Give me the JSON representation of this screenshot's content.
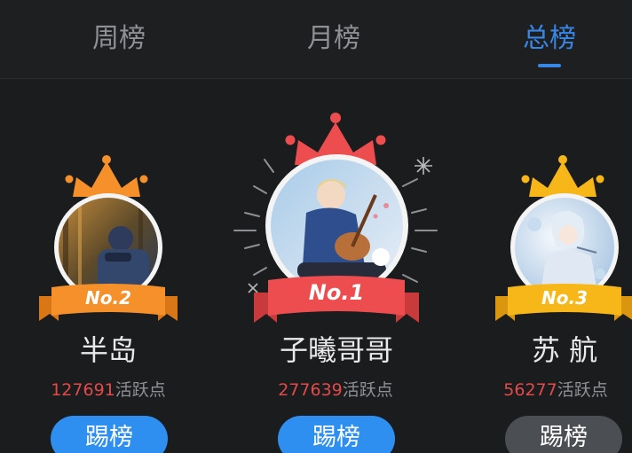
{
  "tabs": {
    "weekly": "周榜",
    "monthly": "月榜",
    "total": "总榜",
    "active_tab": "total"
  },
  "podium": [
    {
      "rank_label": "No.2",
      "name": "半岛",
      "activity_value": "127691",
      "activity_unit": "活跃点",
      "button_label": "踢榜",
      "button_state": "active",
      "crown_color": "#f5902a",
      "ribbon_color": "#f5902a"
    },
    {
      "rank_label": "No.1",
      "name": "子曦哥哥",
      "activity_value": "277639",
      "activity_unit": "活跃点",
      "button_label": "踢榜",
      "button_state": "active",
      "crown_color": "#ee4d4f",
      "ribbon_color": "#ee4d4f"
    },
    {
      "rank_label": "No.3",
      "name": "苏 航",
      "activity_value": "56277",
      "activity_unit": "活跃点",
      "button_label": "踢榜",
      "button_state": "disabled",
      "crown_color": "#f7b718",
      "ribbon_color": "#f7b718"
    }
  ],
  "colors": {
    "background": "#1b1c1e",
    "accent": "#3a86e6",
    "activity_number": "#e24a4a",
    "button_active": "#2f8ff0",
    "button_disabled": "#4b4e52"
  }
}
